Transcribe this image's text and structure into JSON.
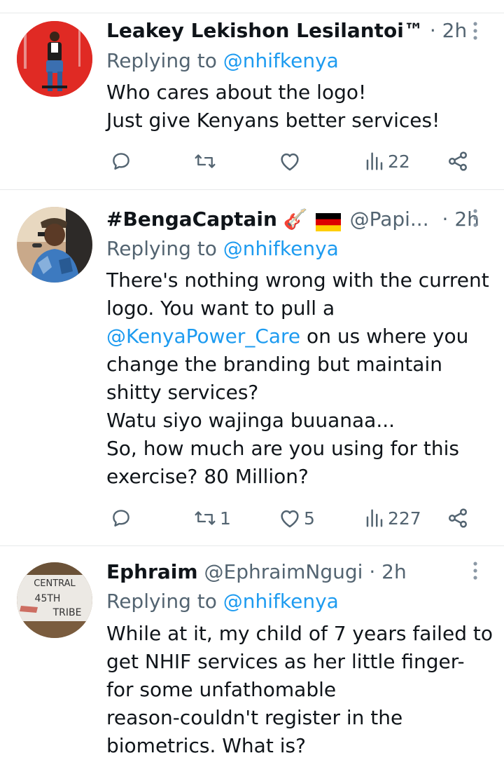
{
  "tweets": [
    {
      "name": "Leakey Lekishon Lesilantoi™",
      "handle": "",
      "dot": "·",
      "time": "2h",
      "replying_prefix": "Replying to ",
      "replying_to": "@nhifkenya",
      "lines": [
        [
          "Who cares about the logo!"
        ],
        [
          "Just give Kenyans better services!"
        ]
      ],
      "reply_count": "",
      "retweet_count": "",
      "like_count": "",
      "view_count": "22"
    },
    {
      "name": "#BengaCaptain",
      "name_emoji": "🎸",
      "handle": "@Papi...",
      "dot": "·",
      "time": "2h",
      "replying_prefix": "Replying to ",
      "replying_to": "@nhifkenya",
      "lines": [
        "There's nothing wrong with the current",
        "logo. You want to pull a",
        "",
        "change the branding but maintain",
        "shitty services?",
        "Watu siyo wajinga buuanaa...",
        "So, how much are you using for this",
        "exercise? 80 Million?"
      ],
      "line3_mention": "@KenyaPower_Care",
      "line3_rest": " on us where you",
      "reply_count": "",
      "retweet_count": "1",
      "like_count": "5",
      "view_count": "227"
    },
    {
      "name": "Ephraim",
      "handle": "@EphraimNgugi",
      "dot": "·",
      "time": "2h",
      "replying_prefix": "Replying to ",
      "replying_to": "@nhifkenya",
      "lines": [
        "While at it, my child of 7 years failed to",
        "get NHIF services as her little finger-",
        "for some unfathomable",
        "reason-couldn't register in the",
        "biometrics. What is?"
      ],
      "avatar_text": [
        "CENTRAL",
        "45TH",
        "TRIBE"
      ]
    }
  ],
  "colors": {
    "text": "#0f1419",
    "secondary": "#536471",
    "link": "#1d9bf0",
    "divider": "#e7e9ea"
  },
  "icons": [
    "reply-icon",
    "retweet-icon",
    "like-icon",
    "views-icon",
    "share-icon",
    "more-icon"
  ]
}
